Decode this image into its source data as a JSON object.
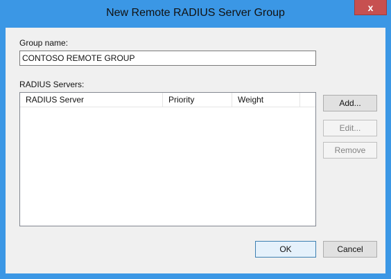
{
  "window": {
    "title": "New Remote RADIUS Server Group",
    "close_glyph": "x"
  },
  "group": {
    "label": "Group name:",
    "value": "CONTOSO REMOTE GROUP"
  },
  "servers": {
    "label": "RADIUS Servers:",
    "columns": [
      "RADIUS Server",
      "Priority",
      "Weight"
    ],
    "rows": []
  },
  "buttons": {
    "add": "Add...",
    "edit": "Edit...",
    "remove": "Remove",
    "ok": "OK",
    "cancel": "Cancel"
  },
  "colors": {
    "titlebar": "#3b97e5",
    "close": "#c75050",
    "client": "#f0f0f0"
  }
}
